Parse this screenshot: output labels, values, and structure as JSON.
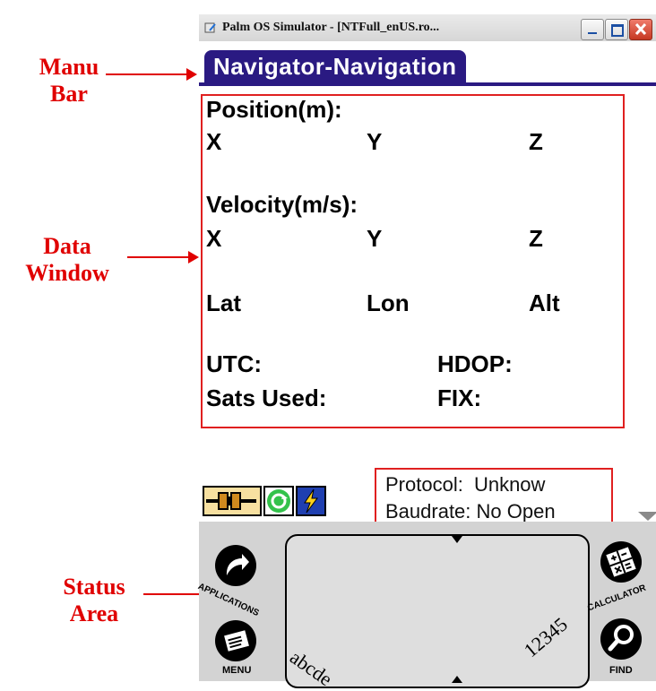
{
  "annotations": {
    "menu_bar": "Manu\nBar",
    "data_window": "Data\nWindow",
    "status_area": "Status\nArea"
  },
  "window": {
    "title": "Palm OS Simulator - [NTFull_enUS.ro..."
  },
  "app": {
    "title": "Navigator-Navigation"
  },
  "data_window": {
    "position_heading": "Position(m):",
    "pos_x": "X",
    "pos_y": "Y",
    "pos_z": "Z",
    "velocity_heading": "Velocity(m/s):",
    "vel_x": "X",
    "vel_y": "Y",
    "vel_z": "Z",
    "lat": "Lat",
    "lon": "Lon",
    "alt": "Alt",
    "utc": "UTC:",
    "hdop": "HDOP:",
    "sats_used": "Sats Used:",
    "fix": "FIX:"
  },
  "status": {
    "protocol_label": "Protocol:",
    "protocol_value": "Unknow",
    "baudrate_label": "Baudrate:",
    "baudrate_value": "No Open"
  },
  "silkscreen": {
    "applications": "APPLICATIONS",
    "menu": "MENU",
    "calculator": "CALCULATOR",
    "find": "FIND",
    "letters": "abcde",
    "numbers": "12345"
  },
  "colors": {
    "annotation_red": "#e00000",
    "menu_bar_navy": "#2a1a82",
    "highlight_box_red": "#e02020"
  }
}
